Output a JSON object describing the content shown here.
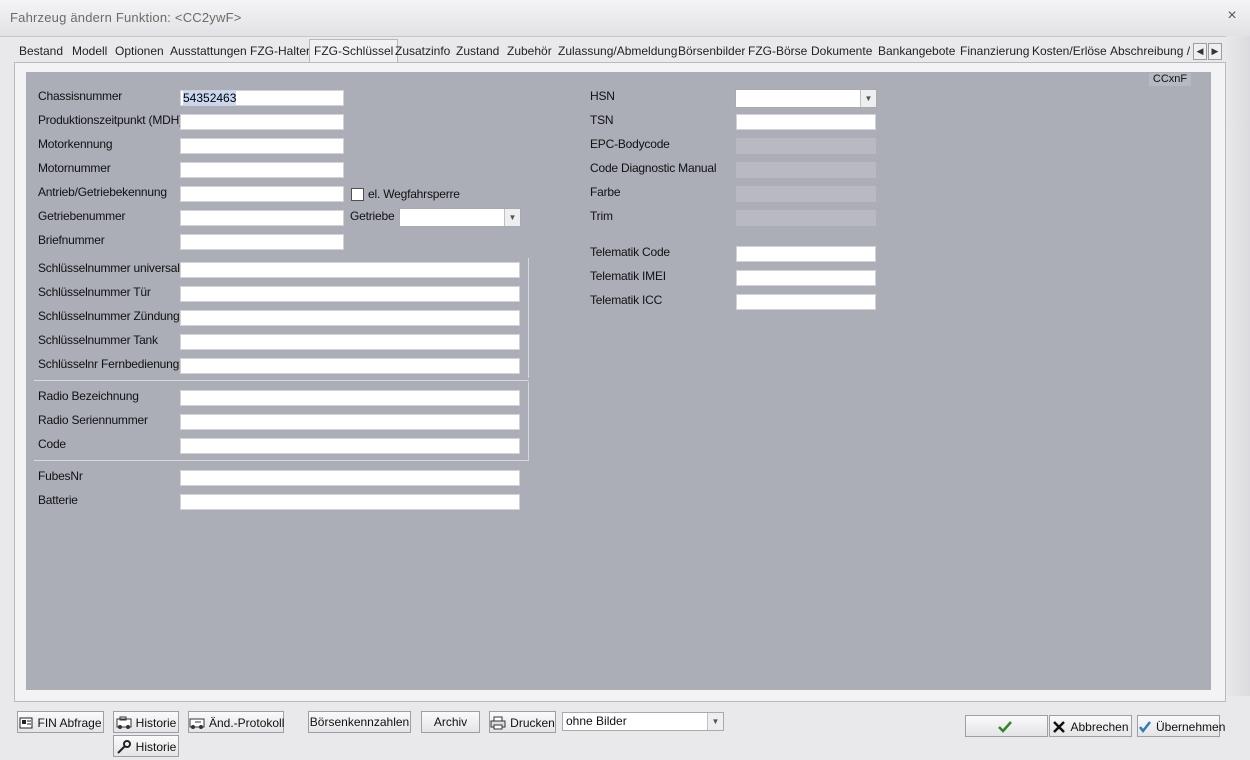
{
  "window": {
    "title": "Fahrzeug ändern   Funktion: <CC2ywF>",
    "close_glyph": "×"
  },
  "tabs": [
    "Bestand",
    "Modell",
    "Optionen",
    "Ausstattungen",
    "FZG-Halter",
    "FZG-Schlüssel",
    "Zusatzinfo",
    "Zustand",
    "Zubehör",
    "Zulassung/Abmeldung",
    "Börsenbilder",
    "FZG-Börse",
    "Dokumente",
    "Bankangebote",
    "Finanzierung",
    "Kosten/Erlöse",
    "Abschreibung / V"
  ],
  "active_tab": "FZG-Schlüssel",
  "code_tag": "CCxnF",
  "left_form": {
    "chassisnummer": {
      "label": "Chassisnummer",
      "value": "54352463"
    },
    "produktionszeitpunkt": {
      "label": "Produktionszeitpunkt (MDH)",
      "value": ""
    },
    "motorkennung": {
      "label": "Motorkennung",
      "value": ""
    },
    "motornummer": {
      "label": "Motornummer",
      "value": ""
    },
    "antrieb": {
      "label": "Antrieb/Getriebekennung",
      "value": ""
    },
    "wegfahrsperre": {
      "label": "el. Wegfahrsperre",
      "checked": false
    },
    "getriebenummer": {
      "label": "Getriebenummer",
      "value": ""
    },
    "getriebe": {
      "label": "Getriebe",
      "value": ""
    },
    "briefnummer": {
      "label": "Briefnummer",
      "value": ""
    },
    "schluessel_universal": {
      "label": "Schlüsselnummer universal",
      "value": ""
    },
    "schluessel_tuer": {
      "label": "Schlüsselnummer Tür",
      "value": ""
    },
    "schluessel_zuendung": {
      "label": "Schlüsselnummer Zündung",
      "value": ""
    },
    "schluessel_tank": {
      "label": "Schlüsselnummer Tank",
      "value": ""
    },
    "schluessel_fernbedienung": {
      "label": "Schlüsselnr Fernbedienung",
      "value": ""
    },
    "radio_bezeichnung": {
      "label": "Radio Bezeichnung",
      "value": ""
    },
    "radio_seriennummer": {
      "label": "Radio Seriennummer",
      "value": ""
    },
    "code": {
      "label": "Code",
      "value": ""
    },
    "fubesnr": {
      "label": "FubesNr",
      "value": ""
    },
    "batterie": {
      "label": "Batterie",
      "value": ""
    }
  },
  "right_form": {
    "hsn": {
      "label": "HSN",
      "value": ""
    },
    "tsn": {
      "label": "TSN",
      "value": ""
    },
    "epc_bodycode": {
      "label": "EPC-Bodycode",
      "value": ""
    },
    "code_diagnostic": {
      "label": "Code Diagnostic Manual",
      "value": ""
    },
    "farbe": {
      "label": "Farbe",
      "value": ""
    },
    "trim": {
      "label": "Trim",
      "value": ""
    },
    "telematik_code": {
      "label": "Telematik Code",
      "value": ""
    },
    "telematik_imei": {
      "label": "Telematik IMEI",
      "value": ""
    },
    "telematik_icc": {
      "label": "Telematik ICC",
      "value": ""
    }
  },
  "toolbar": {
    "fin_abfrage": "FIN Abfrage",
    "historie": "Historie",
    "aend_protokoll": "Änd.-Protokoll",
    "boersenkennzahlen": "Börsenkennzahlen",
    "archiv": "Archiv",
    "drucken": "Drucken",
    "print_option": "ohne Bilder",
    "historie_popup": "Historie",
    "ok_label": "OK",
    "abbrechen": "Abbrechen",
    "uebernehmen": "Übernehmen"
  },
  "icons": {
    "fin": "fin-query-icon",
    "historie": "history-icon",
    "protokoll": "change-log-icon",
    "drucken": "printer-icon",
    "wrench": "wrench-icon",
    "ok": "checkmark-icon",
    "abbrechen": "cancel-x-icon",
    "uebernehmen": "apply-check-icon"
  },
  "colors": {
    "panel": "#abadb7",
    "disabled_field": "#b8b9c1",
    "selected_text": "#c9d7f0"
  }
}
